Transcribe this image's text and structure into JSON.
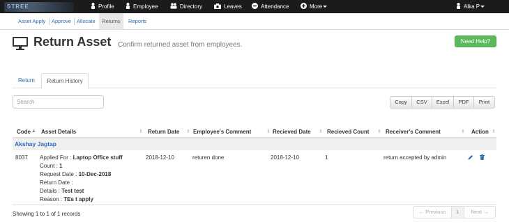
{
  "topnav": {
    "brand": "STREE",
    "items": [
      {
        "label": "Profile",
        "icon": "user-icon"
      },
      {
        "label": "Employee",
        "icon": "user-icon"
      },
      {
        "label": "Directory",
        "icon": "users-icon"
      },
      {
        "label": "Leaves",
        "icon": "camera-icon"
      },
      {
        "label": "Attendance",
        "icon": "minus-circle-icon"
      },
      {
        "label": "More",
        "icon": "plus-circle-icon"
      }
    ],
    "user": "Alka P"
  },
  "subnav": {
    "items": [
      "Asset Apply",
      "Approve",
      "Allocate",
      "Returns",
      "Reports"
    ],
    "active": "Returns"
  },
  "header": {
    "title": "Return Asset",
    "subtitle": "Confirm returned asset from employees.",
    "help_button": "Need Help?"
  },
  "tabs": [
    "Return",
    "Return History"
  ],
  "search": {
    "placeholder": "Search",
    "value": ""
  },
  "export_buttons": [
    "Copy",
    "CSV",
    "Excel",
    "PDF",
    "Print"
  ],
  "table": {
    "columns": [
      "Code",
      "Asset Details",
      "Return Date",
      "Employee's Comment",
      "Recieved Date",
      "Recieved Count",
      "Receiver's Comment",
      "Action"
    ],
    "group": "Akshay Jagtap",
    "row": {
      "code": "8037",
      "details": [
        {
          "label": "Applied For : ",
          "value": "Laptop Office stuff"
        },
        {
          "label": "Count : ",
          "value": "1"
        },
        {
          "label": "Request Date : ",
          "value": "10-Dec-2018"
        },
        {
          "label": "Return Date : ",
          "value": ""
        },
        {
          "label": "Details : ",
          "value": "Test test"
        },
        {
          "label": "Reason : ",
          "value": "TEs t apply"
        }
      ],
      "return_date": "2018-12-10",
      "employee_comment": "returen done",
      "received_date": "2018-12-10",
      "received_count": "1",
      "receiver_comment": "return accepted by admin"
    }
  },
  "footer": {
    "info": "Showing 1 to 1 of 1 records",
    "pager": [
      "← Previous",
      "1",
      "Next →"
    ]
  },
  "colors": {
    "navbar": "#1b1b1b",
    "link": "#2a6ab5",
    "help_button": "#5cb85c"
  }
}
